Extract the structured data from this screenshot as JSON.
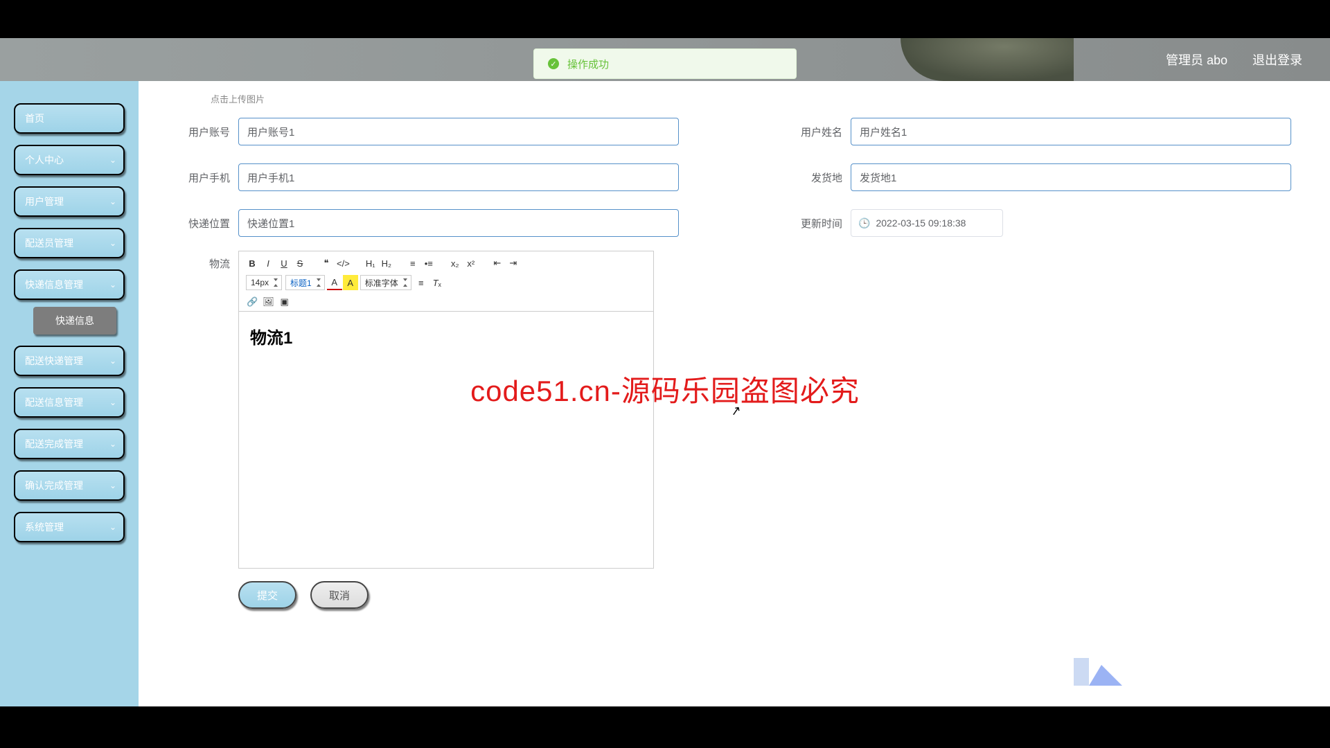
{
  "header": {
    "admin_label": "管理员 abo",
    "logout_label": "退出登录"
  },
  "toast": {
    "message": "操作成功"
  },
  "sidebar": {
    "items": [
      {
        "label": "首页",
        "expandable": false
      },
      {
        "label": "个人中心",
        "expandable": true
      },
      {
        "label": "用户管理",
        "expandable": true
      },
      {
        "label": "配送员管理",
        "expandable": true
      },
      {
        "label": "快递信息管理",
        "expandable": true,
        "active": true
      },
      {
        "label": "配送快递管理",
        "expandable": true
      },
      {
        "label": "配送信息管理",
        "expandable": true
      },
      {
        "label": "配送完成管理",
        "expandable": true
      },
      {
        "label": "确认完成管理",
        "expandable": true
      },
      {
        "label": "系统管理",
        "expandable": true
      }
    ],
    "sub_item": "快递信息"
  },
  "form": {
    "upload_hint": "点击上传图片",
    "labels": {
      "user_account": "用户账号",
      "user_name": "用户姓名",
      "user_phone": "用户手机",
      "ship_from": "发货地",
      "express_pos": "快递位置",
      "update_time": "更新时间",
      "logistics": "物流"
    },
    "values": {
      "user_account": "用户账号1",
      "user_name": "用户姓名1",
      "user_phone": "用户手机1",
      "ship_from": "发货地1",
      "express_pos": "快递位置1",
      "update_time": "2022-03-15 09:18:38"
    },
    "editor": {
      "font_size": "14px",
      "heading": "标题1",
      "font_family": "标准字体",
      "content": "物流1"
    },
    "buttons": {
      "submit": "提交",
      "cancel": "取消"
    }
  },
  "watermark": {
    "repeat_text": "code51.cn",
    "center_text": "code51.cn-源码乐园盗图必究"
  }
}
